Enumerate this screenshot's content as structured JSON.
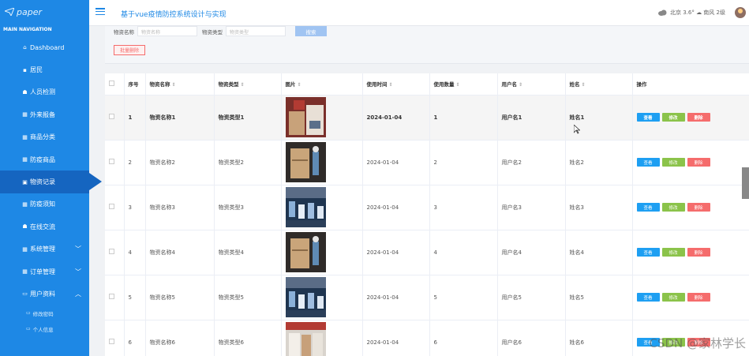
{
  "app": {
    "logo_text": "paper",
    "title": "基于vue疫情防控系统设计与实现"
  },
  "weather": {
    "text": "北京  3.6°  ☁ 南风  2级"
  },
  "sidebar": {
    "header": "MAIN NAVIGATION",
    "items": [
      {
        "label": "Dashboard",
        "icon": "home-icon"
      },
      {
        "label": "居民",
        "icon": "chat-icon"
      },
      {
        "label": "人员检测",
        "icon": "person-icon"
      },
      {
        "label": "外来报备",
        "icon": "grid-icon"
      },
      {
        "label": "商品分类",
        "icon": "grid-icon"
      },
      {
        "label": "防疫商品",
        "icon": "grid-icon"
      },
      {
        "label": "物资记录",
        "icon": "bag-icon",
        "active": true
      },
      {
        "label": "防疫须知",
        "icon": "grid-icon"
      },
      {
        "label": "在线交流",
        "icon": "person-icon"
      },
      {
        "label": "系统管理",
        "icon": "grid-icon",
        "chevron": "down"
      },
      {
        "label": "订单管理",
        "icon": "grid-icon",
        "chevron": "down"
      },
      {
        "label": "用户资料",
        "icon": "folder-icon",
        "chevron": "up"
      }
    ],
    "subitems": [
      {
        "label": "修改密码"
      },
      {
        "label": "个人信息"
      }
    ]
  },
  "search": {
    "name_label": "物资名称",
    "name_placeholder": "物资名称",
    "type_label": "物资类型",
    "type_placeholder": "物资类型",
    "search_button": "搜索",
    "batch_delete_button": "批量删除"
  },
  "table": {
    "headers": {
      "index": "序号",
      "name": "物资名称",
      "type": "物资类型",
      "image": "图片",
      "time": "使用时间",
      "count": "使用数量",
      "username": "用户名",
      "realname": "姓名",
      "actions": "操作"
    },
    "buttons": {
      "view": "查看",
      "edit": "修改",
      "delete": "删除"
    },
    "rows": [
      {
        "index": "1",
        "name": "物资名称1",
        "type": "物资类型1",
        "time": "2024-01-04",
        "count": "1",
        "username": "用户名1",
        "realname": "姓名1"
      },
      {
        "index": "2",
        "name": "物资名称2",
        "type": "物资类型2",
        "time": "2024-01-04",
        "count": "2",
        "username": "用户名2",
        "realname": "姓名2"
      },
      {
        "index": "3",
        "name": "物资名称3",
        "type": "物资类型3",
        "time": "2024-01-04",
        "count": "3",
        "username": "用户名3",
        "realname": "姓名3"
      },
      {
        "index": "4",
        "name": "物资名称4",
        "type": "物资类型4",
        "time": "2024-01-04",
        "count": "4",
        "username": "用户名4",
        "realname": "姓名4"
      },
      {
        "index": "5",
        "name": "物资名称5",
        "type": "物资类型5",
        "time": "2024-01-04",
        "count": "5",
        "username": "用户名5",
        "realname": "姓名5"
      },
      {
        "index": "6",
        "name": "物资名称6",
        "type": "物资类型6",
        "time": "2024-01-04",
        "count": "6",
        "username": "用户名6",
        "realname": "姓名6"
      }
    ]
  },
  "watermark": "CSDN @家林学长",
  "colors": {
    "sidebar": "#1e88e5",
    "sidebar_active": "#1565c0",
    "view_button": "#1e9ff2",
    "edit_button": "#8bc34a",
    "delete_button": "#f56c6c"
  }
}
